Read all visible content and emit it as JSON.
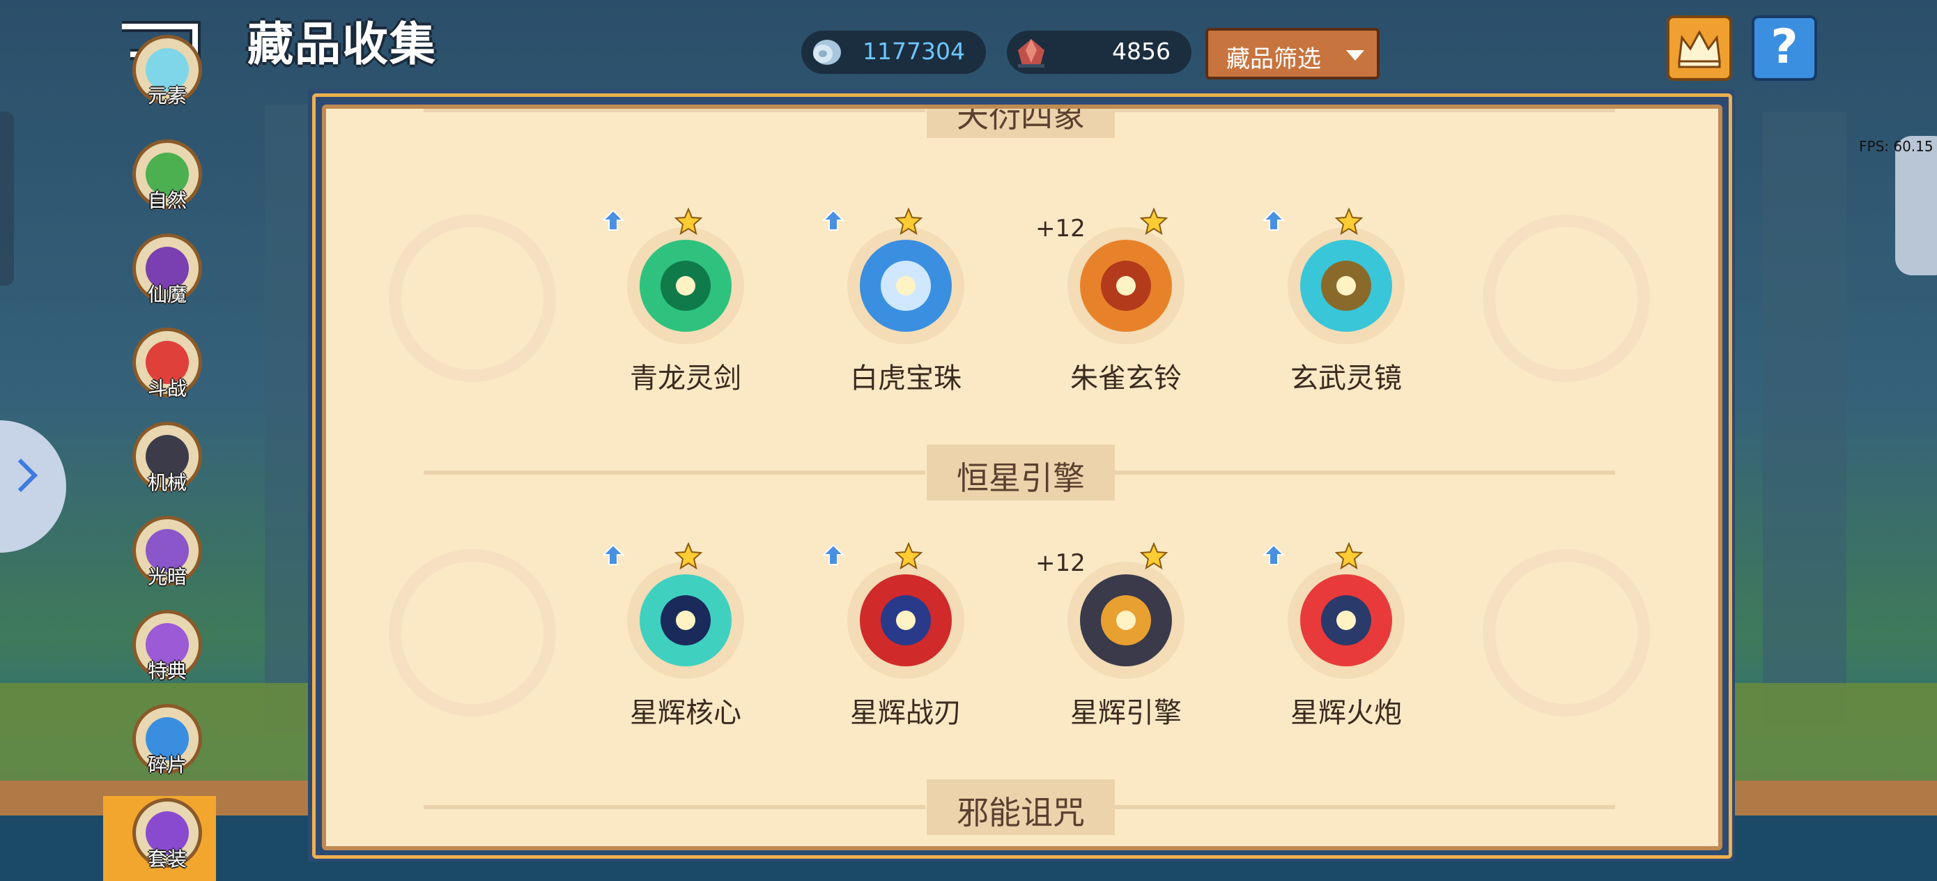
{
  "header": {
    "title": "藏品收集",
    "currency_silver": "1177304",
    "currency_gem": "4856",
    "filter_label": "藏品筛选"
  },
  "overlay": {
    "fps_label": "FPS: 60.15"
  },
  "tabs": [
    {
      "label": "元素"
    },
    {
      "label": "自然"
    },
    {
      "label": "仙魔"
    },
    {
      "label": "斗战"
    },
    {
      "label": "机械"
    },
    {
      "label": "光暗"
    },
    {
      "label": "特典"
    },
    {
      "label": "碎片"
    },
    {
      "label": "套装"
    }
  ],
  "active_tab": "套装",
  "sections": [
    {
      "title": "天衍四象",
      "items": [
        {
          "name": "青龙灵剑",
          "badge": "up",
          "enhance": ""
        },
        {
          "name": "白虎宝珠",
          "badge": "up",
          "enhance": ""
        },
        {
          "name": "朱雀玄铃",
          "badge": "",
          "enhance": "+12"
        },
        {
          "name": "玄武灵镜",
          "badge": "up",
          "enhance": ""
        }
      ]
    },
    {
      "title": "恒星引擎",
      "items": [
        {
          "name": "星辉核心",
          "badge": "up",
          "enhance": ""
        },
        {
          "name": "星辉战刃",
          "badge": "up",
          "enhance": ""
        },
        {
          "name": "星辉引擎",
          "badge": "",
          "enhance": "+12"
        },
        {
          "name": "星辉火炮",
          "badge": "up",
          "enhance": ""
        }
      ]
    },
    {
      "title": "邪能诅咒",
      "items": []
    }
  ],
  "colors": {
    "panel_bg": "#fbe9c6",
    "panel_border": "#2c4a72",
    "filter_btn": "#c8743e",
    "help_btn": "#3b8fe0",
    "crown_btn": "#f0a030",
    "star": "#ffcc33",
    "up_arrow": "#4a90e2"
  },
  "icons": {
    "back": "back-arrow-icon",
    "silver": "silver-coin-icon",
    "gem": "red-gem-icon",
    "crown": "crown-icon",
    "help": "question-icon",
    "star": "star-icon",
    "up": "upgrade-arrow-icon"
  }
}
